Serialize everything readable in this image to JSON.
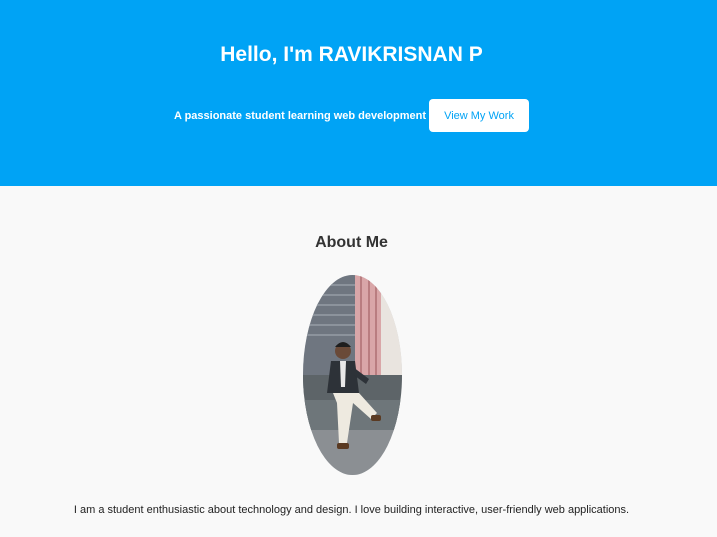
{
  "hero": {
    "title": "Hello, I'm RAVIKRISNAN P",
    "tagline": "A passionate student learning web development",
    "button_label": "View My Work"
  },
  "about": {
    "heading": "About Me",
    "photo": "profile-photo",
    "text": "I am a student enthusiastic about technology and design. I love building interactive, user-friendly web applications."
  },
  "colors": {
    "accent": "#00a3f5",
    "background": "#f9f9f9",
    "heading": "#333333"
  }
}
